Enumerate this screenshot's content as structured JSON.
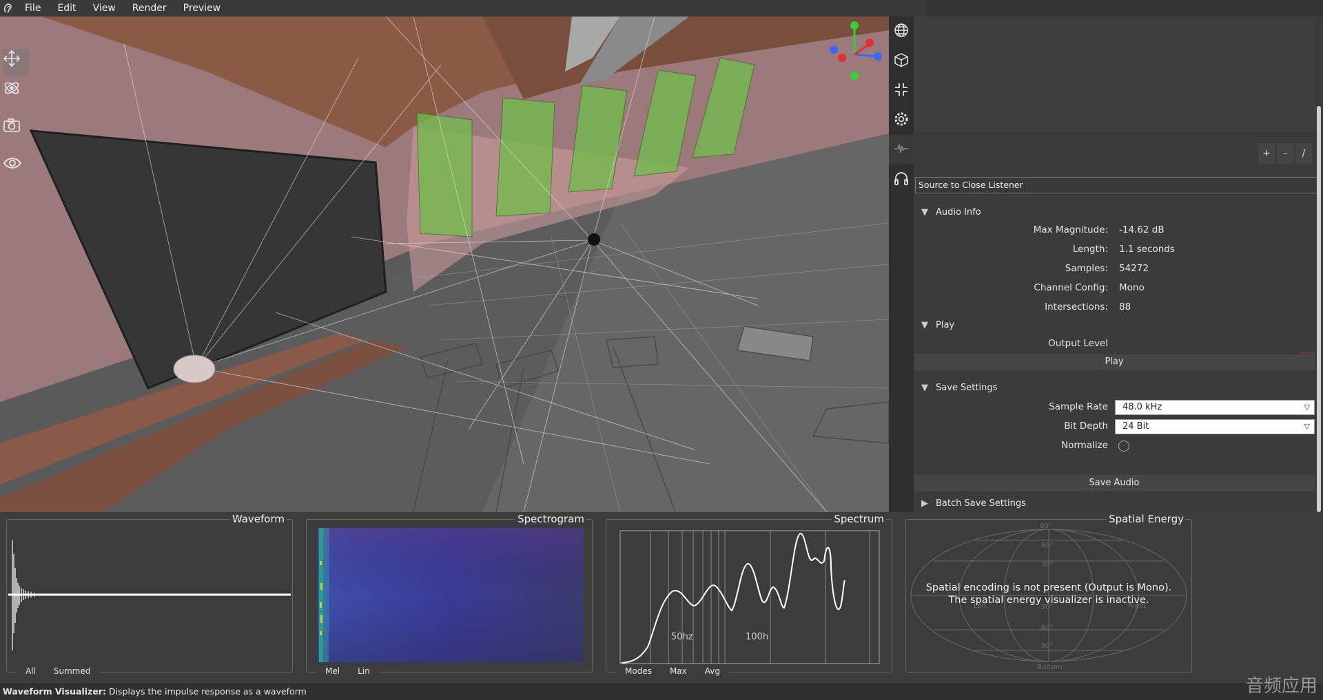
{
  "menu": {
    "logo_icon": "ear-logo-icon",
    "items": [
      "File",
      "Edit",
      "View",
      "Render",
      "Preview"
    ]
  },
  "viewport_tools": {
    "move_icon": "move-arrows-icon",
    "orbit_icon": "orbit-icon",
    "camera_icon": "camera-icon",
    "visibility_icon": "eye-icon"
  },
  "icon_strip": [
    "globe-icon",
    "cube-icon",
    "compress-icon",
    "gear-icon",
    "waveform-icon",
    "headphones-icon"
  ],
  "right_panel": {
    "list_buttons": [
      "+",
      "-",
      "/"
    ],
    "selected_name": "Source to Close Listener",
    "audio_info": {
      "header": "Audio Info",
      "rows": [
        {
          "label": "Max Magnitude:",
          "value": "-14.62 dB"
        },
        {
          "label": "Length:",
          "value": "1.1 seconds"
        },
        {
          "label": "Samples:",
          "value": "54272"
        },
        {
          "label": "Channel Config:",
          "value": "Mono"
        },
        {
          "label": "Intersections:",
          "value": "88"
        }
      ]
    },
    "play": {
      "header": "Play",
      "output_level_label": "Output Level",
      "play_button": "Play"
    },
    "save_settings": {
      "header": "Save Settings",
      "sample_rate_label": "Sample Rate",
      "sample_rate_value": "48.0 kHz",
      "bit_depth_label": "Bit Depth",
      "bit_depth_value": "24 Bit",
      "normalize_label": "Normalize",
      "save_button": "Save Audio"
    },
    "batch_save": {
      "header": "Batch Save Settings"
    }
  },
  "panels": {
    "waveform": {
      "title": "Waveform",
      "tabs": [
        "All",
        "Summed"
      ]
    },
    "spectrogram": {
      "title": "Spectrogram",
      "tabs": [
        "Mel",
        "Lin"
      ]
    },
    "spectrum": {
      "title": "Spectrum",
      "tabs": [
        "Modes",
        "Max",
        "Avg"
      ],
      "tick_labels": [
        "50hz",
        "100h"
      ]
    },
    "spatial": {
      "title": "Spatial Energy",
      "message_line1": "Spatial encoding is not present (Output is Mono).",
      "message_line2": "The spatial energy visualizer is inactive.",
      "grid_labels": [
        "90°",
        "60°",
        "30°",
        "-30°",
        "-60°",
        "-90°",
        "Left",
        "Right",
        "Bottom"
      ]
    }
  },
  "status": {
    "bold": "Waveform Visualizer:",
    "text": " Displays the impulse response as a waveform"
  },
  "watermark": "音频应用",
  "colors": {
    "accent_green": "#6fbf4a",
    "wall_pink": "#a07a7a",
    "wood": "#8a5a45",
    "meter_red": "#7a2a2a"
  }
}
